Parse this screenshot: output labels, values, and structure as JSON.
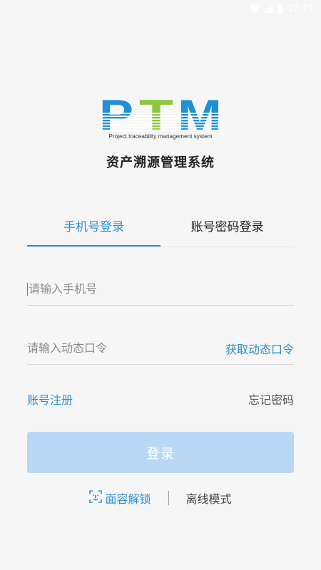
{
  "status_bar": {
    "time": "17:21"
  },
  "logo": {
    "letters": "PTM",
    "tagline": "Project traceability management system",
    "colors": {
      "p": "#1f8fd8",
      "t": "#8cc63e",
      "m": "#1f8fd8"
    }
  },
  "app_title": "资产溯源管理系统",
  "tabs": [
    {
      "label": "手机号登录",
      "active": true
    },
    {
      "label": "账号密码登录",
      "active": false
    }
  ],
  "phone_input": {
    "value": "",
    "placeholder": "请输入手机号"
  },
  "otp_input": {
    "value": "",
    "placeholder": "请输入动态口令",
    "get_code_label": "获取动态口令"
  },
  "links": {
    "register": "账号注册",
    "forgot_password": "忘记密码"
  },
  "login_button": "登录",
  "bottom": {
    "face_unlock": "面容解锁",
    "offline_mode": "离线模式"
  },
  "colors": {
    "accent": "#2f8fd3",
    "button_disabled": "#b8d8f5",
    "background": "#f6f6f6"
  }
}
